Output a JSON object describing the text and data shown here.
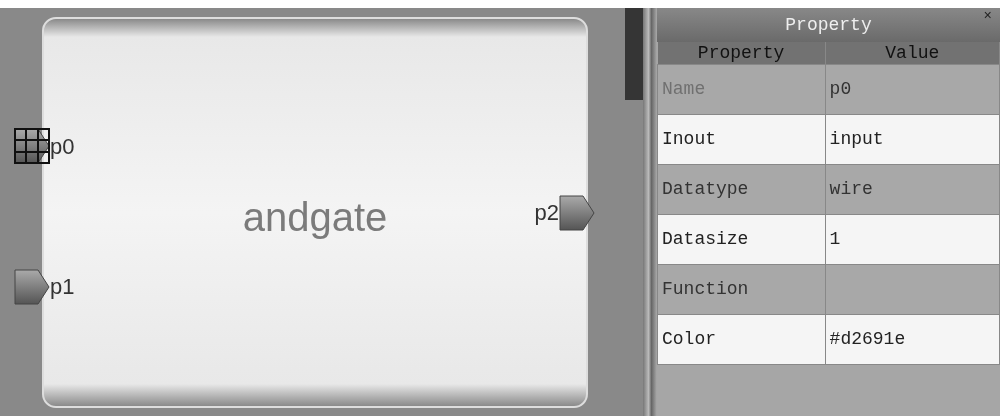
{
  "block": {
    "title": "andgate",
    "left_ports": [
      {
        "label": "p0",
        "selected": true
      },
      {
        "label": "p1",
        "selected": false
      }
    ],
    "right_ports": [
      {
        "label": "p2",
        "selected": false
      }
    ]
  },
  "property_panel": {
    "title": "Property",
    "close": "×",
    "columns": [
      "Property",
      "Value"
    ],
    "rows": [
      {
        "property": "Name",
        "value": "p0",
        "disabled": true
      },
      {
        "property": "Inout",
        "value": "input",
        "disabled": false
      },
      {
        "property": "Datatype",
        "value": "wire",
        "disabled": false
      },
      {
        "property": "Datasize",
        "value": "1",
        "disabled": false
      },
      {
        "property": "Function",
        "disabled": false
      },
      {
        "property": "Color",
        "value": "#d2691e",
        "disabled": false
      }
    ]
  }
}
